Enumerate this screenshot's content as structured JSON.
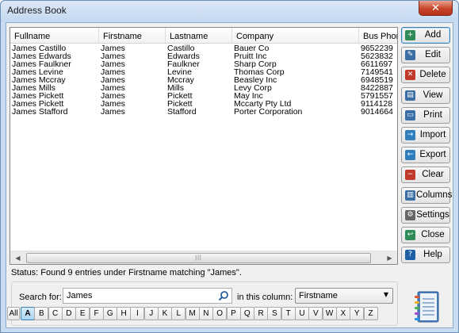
{
  "window": {
    "title": "Address Book",
    "close_glyph": "✕"
  },
  "list": {
    "columns": [
      "Fullname",
      "Firstname",
      "Lastname",
      "Company",
      "Bus Phon"
    ],
    "rows": [
      [
        "James Castillo",
        "James",
        "Castillo",
        "Bauer Co",
        "9652239"
      ],
      [
        "James Edwards",
        "James",
        "Edwards",
        "Pruitt Inc",
        "5623832"
      ],
      [
        "James Faulkner",
        "James",
        "Faulkner",
        "Sharp Corp",
        "6611697"
      ],
      [
        "James Levine",
        "James",
        "Levine",
        "Thomas Corp",
        "7149541"
      ],
      [
        "James Mccray",
        "James",
        "Mccray",
        "Beasley Inc",
        "6948519"
      ],
      [
        "James Mills",
        "James",
        "Mills",
        "Levy Corp",
        "8422887"
      ],
      [
        "James Pickett",
        "James",
        "Pickett",
        "May Inc",
        "5791557"
      ],
      [
        "James Pickett",
        "James",
        "Pickett",
        "Mccarty Pty Ltd",
        "9114128"
      ],
      [
        "James Stafford",
        "James",
        "Stafford",
        "Porter Corporation",
        "9014664"
      ]
    ]
  },
  "buttons": [
    {
      "name": "add",
      "label": "Add",
      "icon": "add-contact-icon",
      "color": "#2e8b57"
    },
    {
      "name": "edit",
      "label": "Edit",
      "icon": "edit-icon",
      "color": "#3a6ea5"
    },
    {
      "name": "delete",
      "label": "Delete",
      "icon": "delete-icon",
      "color": "#c0392b"
    },
    {
      "name": "view",
      "label": "View",
      "icon": "view-icon",
      "color": "#3a6ea5"
    },
    {
      "name": "print",
      "label": "Print",
      "icon": "print-icon",
      "color": "#3a6ea5"
    },
    {
      "name": "import",
      "label": "Import",
      "icon": "import-icon",
      "color": "#2f7fbf"
    },
    {
      "name": "export",
      "label": "Export",
      "icon": "export-icon",
      "color": "#2f7fbf"
    },
    {
      "name": "clear",
      "label": "Clear",
      "icon": "clear-icon",
      "color": "#c0392b"
    },
    {
      "name": "columns",
      "label": "Columns",
      "icon": "columns-icon",
      "color": "#3a6ea5"
    },
    {
      "name": "settings",
      "label": "Settings",
      "icon": "gear-icon",
      "color": "#666666"
    },
    {
      "name": "close",
      "label": "Close",
      "icon": "close-circle-icon",
      "color": "#2e8b57"
    },
    {
      "name": "help",
      "label": "Help",
      "icon": "help-icon",
      "color": "#1f5fa8"
    }
  ],
  "status": "Status: Found 9 entries under Firstname matching \"James\".",
  "search": {
    "label": "Search for:",
    "value": "James",
    "column_label": "in this column:",
    "column_value": "Firstname"
  },
  "alphabet": [
    "All",
    "A",
    "B",
    "C",
    "D",
    "E",
    "F",
    "G",
    "H",
    "I",
    "J",
    "K",
    "L",
    "M",
    "N",
    "O",
    "P",
    "Q",
    "R",
    "S",
    "T",
    "U",
    "V",
    "W",
    "X",
    "Y",
    "Z"
  ],
  "alphabet_selected": "A"
}
